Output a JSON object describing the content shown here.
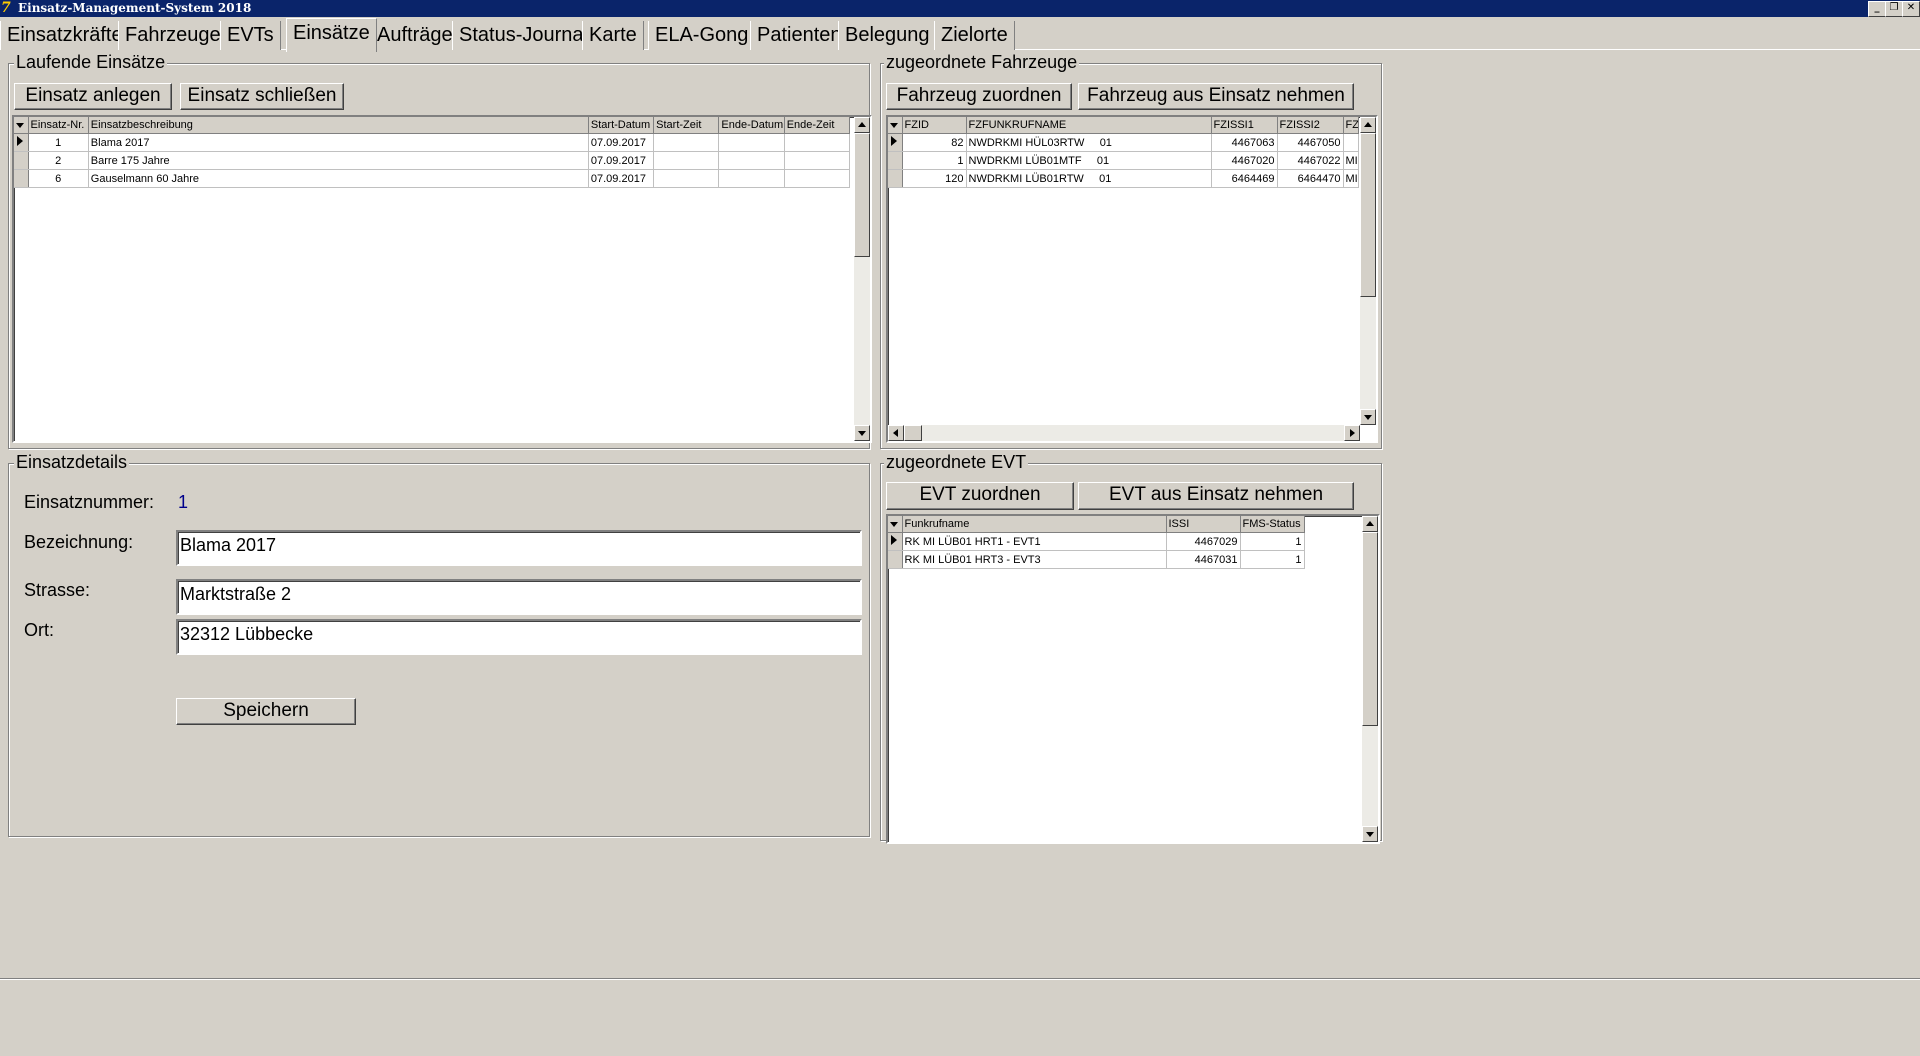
{
  "window": {
    "title": "Einsatz-Management-System 2018"
  },
  "tabs": [
    "Einsatzkräfte",
    "Fahrzeuge",
    "EVTs",
    "Einsätze",
    "Aufträge",
    "Status-Journal",
    "Karte",
    "ELA-Gong",
    "Patienten",
    "Belegung",
    "Zielorte"
  ],
  "active_tab": "Einsätze",
  "laufende": {
    "title": "Laufende Einsätze",
    "btn_add": "Einsatz anlegen",
    "btn_close": "Einsatz schließen",
    "columns": [
      "Einsatz-Nr.",
      "Einsatzbeschreibung",
      "Start-Datum",
      "Start-Zeit",
      "Ende-Datum",
      "Ende-Zeit"
    ],
    "rows": [
      [
        "1",
        "Blama 2017",
        "07.09.2017",
        "",
        "",
        ""
      ],
      [
        "2",
        "Barre 175 Jahre",
        "07.09.2017",
        "",
        "",
        ""
      ],
      [
        "6",
        "Gauselmann 60 Jahre",
        "07.09.2017",
        "",
        "",
        ""
      ]
    ]
  },
  "fahrzeuge": {
    "title": "zugeordnete Fahrzeuge",
    "btn_assign": "Fahrzeug zuordnen",
    "btn_remove": "Fahrzeug aus Einsatz nehmen",
    "columns": [
      "FZID",
      "FZFUNKRUFNAME",
      "FZISSI1",
      "FZISSI2",
      "FZ"
    ],
    "rows": [
      [
        "82",
        "NWDRKMI HÜL03RTW     01",
        "4467063",
        "4467050",
        ""
      ],
      [
        "1",
        "NWDRKMI LÜB01MTF     01",
        "4467020",
        "4467022",
        "MI-"
      ],
      [
        "120",
        "NWDRKMI LÜB01RTW     01",
        "6464469",
        "6464470",
        "MI-"
      ]
    ]
  },
  "details": {
    "title": "Einsatzdetails",
    "nr_label": "Einsatznummer:",
    "nr_value": "1",
    "bez_label": "Bezeichnung:",
    "bez_value": "Blama 2017",
    "str_label": "Strasse:",
    "str_value": "Marktstraße 2",
    "ort_label": "Ort:",
    "ort_value": "32312 Lübbecke",
    "save": "Speichern"
  },
  "evt": {
    "title": "zugeordnete EVT",
    "btn_assign": "EVT zuordnen",
    "btn_remove": "EVT aus Einsatz nehmen",
    "columns": [
      "Funkrufname",
      "ISSI",
      "FMS-Status"
    ],
    "rows": [
      [
        "RK MI LÜB01 HRT1 - EVT1",
        "4467029",
        "1"
      ],
      [
        "RK MI LÜB01 HRT3 - EVT3",
        "4467031",
        "1"
      ]
    ]
  }
}
